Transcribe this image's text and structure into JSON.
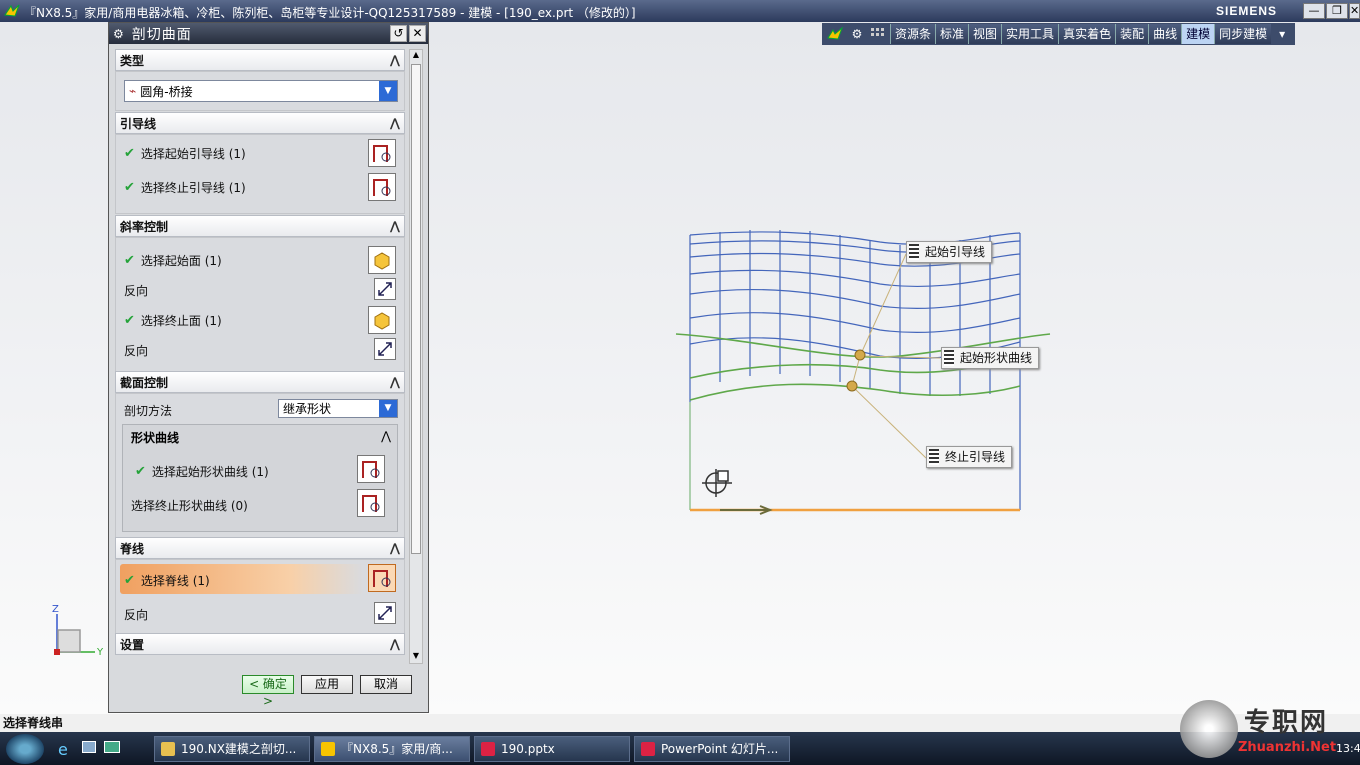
{
  "window": {
    "title": "『NX8.5』家用/商用电器冰箱、冷柜、陈列柜、岛柜等专业设计-QQ125317589 - 建模 - [190_ex.prt （修改的）]",
    "brand": "SIEMENS",
    "controls": [
      "—",
      "❐",
      "✕"
    ]
  },
  "toolbar": {
    "tabs": [
      "资源条",
      "标准",
      "视图",
      "实用工具",
      "真实着色",
      "装配",
      "曲线",
      "建模",
      "同步建模"
    ],
    "active_tab": "建模"
  },
  "dialog": {
    "title": "剖切曲面",
    "sections": {
      "type": {
        "label": "类型",
        "value": "圆角-桥接"
      },
      "guide": {
        "label": "引导线",
        "start": "选择起始引导线 (1)",
        "end": "选择终止引导线 (1)"
      },
      "slope": {
        "label": "斜率控制",
        "start_face": "选择起始面 (1)",
        "reverse1": "反向",
        "end_face": "选择终止面 (1)",
        "reverse2": "反向"
      },
      "section": {
        "label": "截面控制",
        "method_label": "剖切方法",
        "method_value": "继承形状",
        "shape_curve_label": "形状曲线",
        "start_shape": "选择起始形状曲线 (1)",
        "end_shape": "选择终止形状曲线 (0)"
      },
      "spine": {
        "label": "脊线",
        "select": "选择脊线 (1)",
        "reverse": "反向"
      },
      "settings": {
        "label": "设置"
      }
    },
    "buttons": {
      "ok": "< 确定 >",
      "apply": "应用",
      "cancel": "取消"
    }
  },
  "viewport_labels": {
    "start_guide": "起始引导线",
    "start_shape": "起始形状曲线",
    "end_guide": "终止引导线"
  },
  "axis": {
    "z": "Z",
    "y": "Y"
  },
  "status_text": "选择脊线串",
  "taskbar": {
    "items": [
      "190.NX建模之剖切...",
      "『NX8.5』家用/商...",
      "190.pptx",
      "PowerPoint 幻灯片..."
    ],
    "watermark": "专职网",
    "watermark_sub": "Zhuanzhi.Net",
    "clock": "13:4"
  },
  "colors": {
    "accent_blue": "#2c6ad6",
    "check_green": "#25a33a",
    "wire_blue": "#3a5fc0",
    "wire_green": "#5fa84a",
    "orange": "#f0a040"
  }
}
